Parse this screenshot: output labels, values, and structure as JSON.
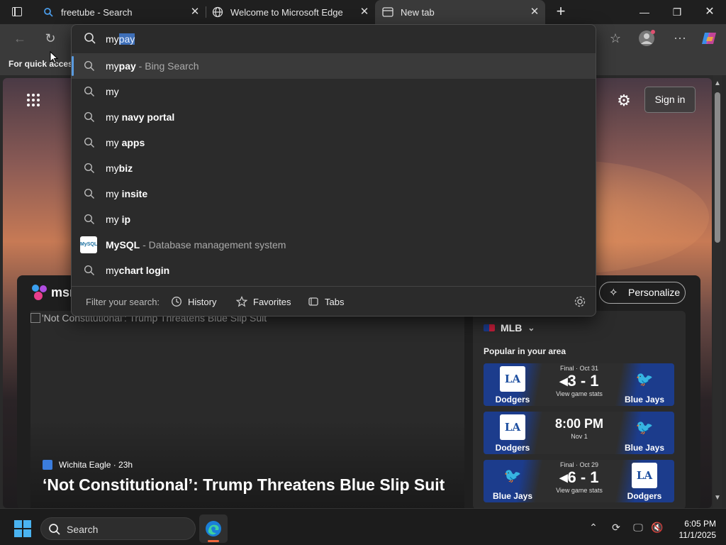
{
  "tabs": [
    {
      "label": "freetube - Search",
      "favicon": "search-icon",
      "active": false
    },
    {
      "label": "Welcome to Microsoft Edge",
      "favicon": "globe-icon",
      "active": false
    },
    {
      "label": "New tab",
      "favicon": "newtab-icon",
      "active": true
    }
  ],
  "toolbar": {
    "favorites_bar_text": "For quick access"
  },
  "address": {
    "typed_prefix": "my",
    "autocomplete_selected": "pay"
  },
  "suggestions": [
    {
      "prefix": "my",
      "bold": "pay",
      "hint": " - Bing Search",
      "icon": "search-icon",
      "highlighted": true
    },
    {
      "prefix": "my",
      "bold": "",
      "hint": "",
      "icon": "search-icon"
    },
    {
      "prefix": "my ",
      "bold": "navy portal",
      "hint": "",
      "icon": "search-icon"
    },
    {
      "prefix": "my ",
      "bold": "apps",
      "hint": "",
      "icon": "search-icon"
    },
    {
      "prefix": "my",
      "bold": "biz",
      "hint": "",
      "icon": "search-icon"
    },
    {
      "prefix": "my ",
      "bold": "insite",
      "hint": "",
      "icon": "search-icon"
    },
    {
      "prefix": "my ",
      "bold": "ip",
      "hint": "",
      "icon": "search-icon"
    },
    {
      "prefix": "",
      "bold": "MySQL",
      "hint": " - Database management system",
      "icon": "mysql-logo"
    },
    {
      "prefix": "my",
      "bold": "chart login",
      "hint": "",
      "icon": "search-icon"
    }
  ],
  "mysql_logo_text": "MySQL",
  "filter": {
    "label": "Filter your search:",
    "chips": [
      "History",
      "Favorites",
      "Tabs"
    ]
  },
  "ntp": {
    "sign_in": "Sign in",
    "msn_text": "msn",
    "personalize": "Personalize",
    "hero_alt": "'Not Constitutional': Trump Threatens Blue Slip Suit",
    "hero_source": "Wichita Eagle · 23h",
    "hero_title": "‘Not Constitutional’: Trump Threatens Blue Slip Suit",
    "sports": {
      "league": "MLB",
      "popular": "Popular in your area",
      "games": [
        {
          "home": "Dodgers",
          "away": "Blue Jays",
          "status": "Final · Oct 31",
          "score": "3 - 1",
          "sub": "View game stats",
          "left_logo": "LA",
          "right_logo": "jay"
        },
        {
          "home": "Dodgers",
          "away": "Blue Jays",
          "status": "",
          "score": "8:00 PM",
          "sub": "Nov 1",
          "left_logo": "LA",
          "right_logo": "jay"
        },
        {
          "home": "Blue Jays",
          "away": "Dodgers",
          "status": "Final · Oct 29",
          "score": "6 - 1",
          "sub": "View game stats",
          "left_logo": "jay",
          "right_logo": "LA"
        }
      ]
    }
  },
  "taskbar": {
    "search_placeholder": "Search",
    "time": "6:05 PM",
    "date": "11/1/2025"
  },
  "colors": {
    "accent_selection": "#3e6fb8",
    "highlight_bar": "#5a9be0",
    "dodgers_blue": "#1c3c8c"
  }
}
